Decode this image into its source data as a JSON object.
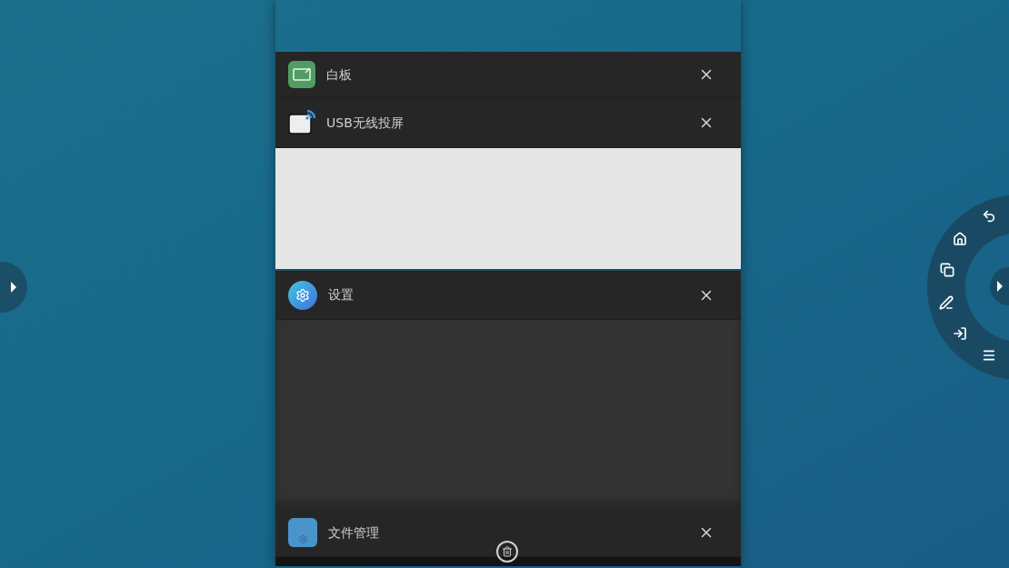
{
  "recent_apps": [
    {
      "title": "白板",
      "kind": "none"
    },
    {
      "title": "USB无线投屏",
      "kind": "light"
    },
    {
      "title": "设置",
      "kind": "dark"
    },
    {
      "title": "文件管理",
      "kind": "edge"
    }
  ]
}
